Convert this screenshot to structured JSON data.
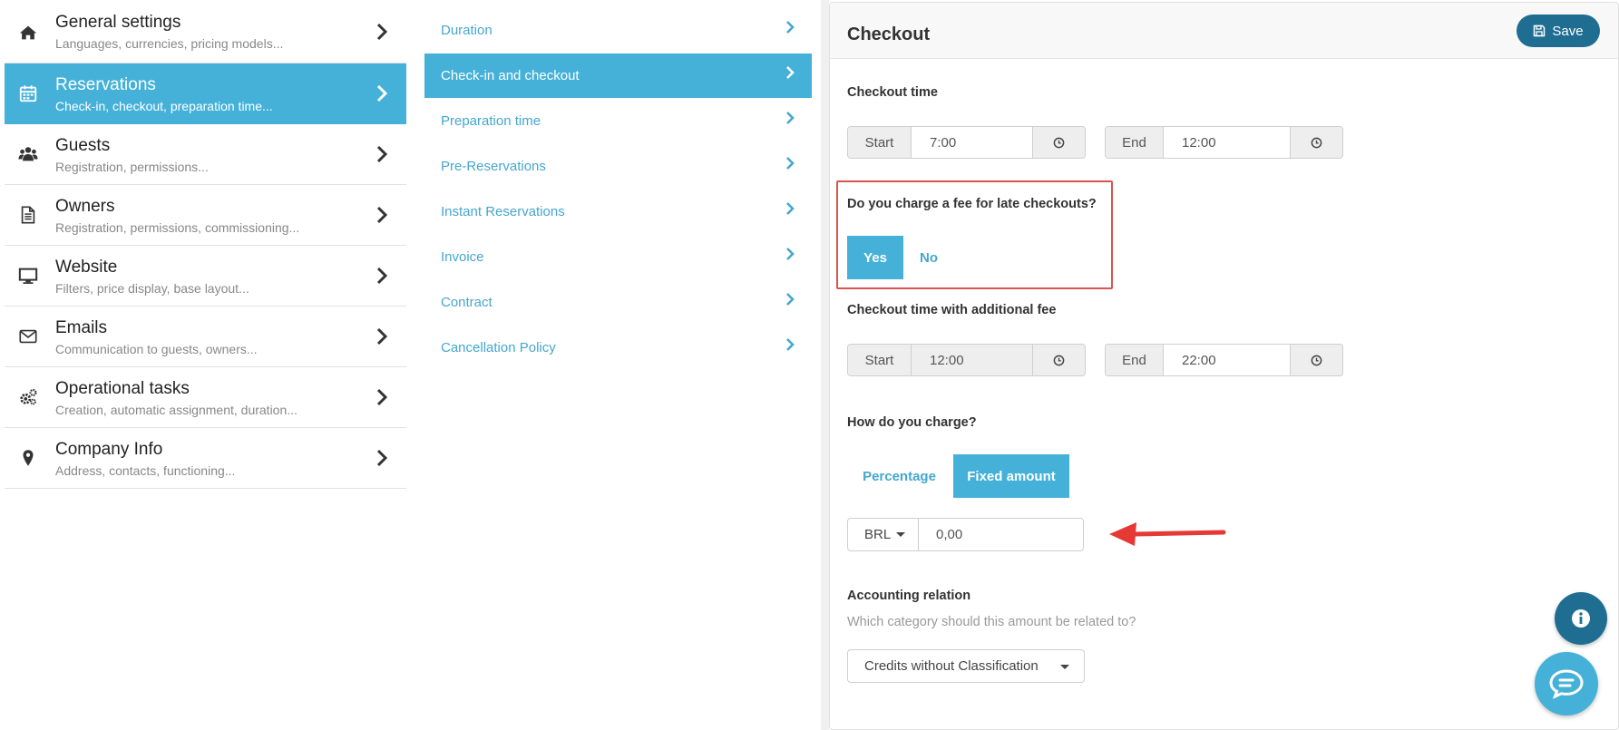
{
  "sidebar": {
    "items": [
      {
        "icon": "home-icon",
        "title": "General settings",
        "subtitle": "Languages, currencies, pricing models...",
        "active": false
      },
      {
        "icon": "calendar-icon",
        "title": "Reservations",
        "subtitle": "Check-in, checkout, preparation time...",
        "active": true
      },
      {
        "icon": "users-icon",
        "title": "Guests",
        "subtitle": "Registration, permissions...",
        "active": false
      },
      {
        "icon": "document-icon",
        "title": "Owners",
        "subtitle": "Registration, permissions, commissioning...",
        "active": false
      },
      {
        "icon": "monitor-icon",
        "title": "Website",
        "subtitle": "Filters, price display, base layout...",
        "active": false
      },
      {
        "icon": "envelope-icon",
        "title": "Emails",
        "subtitle": "Communication to guests, owners...",
        "active": false
      },
      {
        "icon": "gears-icon",
        "title": "Operational tasks",
        "subtitle": "Creation, automatic assignment, duration...",
        "active": false
      },
      {
        "icon": "map-pin-icon",
        "title": "Company Info",
        "subtitle": "Address, contacts, functioning...",
        "active": false
      }
    ]
  },
  "submenu": {
    "items": [
      {
        "label": "Duration",
        "active": false
      },
      {
        "label": "Check-in and checkout",
        "active": true
      },
      {
        "label": "Preparation time",
        "active": false
      },
      {
        "label": "Pre-Reservations",
        "active": false
      },
      {
        "label": "Instant Reservations",
        "active": false
      },
      {
        "label": "Invoice",
        "active": false
      },
      {
        "label": "Contract",
        "active": false
      },
      {
        "label": "Cancellation Policy",
        "active": false
      }
    ]
  },
  "panel": {
    "title": "Checkout",
    "save_label": "Save",
    "checkout_time": {
      "label": "Checkout time",
      "start_label": "Start",
      "start_value": "7:00",
      "end_label": "End",
      "end_value": "12:00"
    },
    "late_fee": {
      "question": "Do you charge a fee for late checkouts?",
      "yes_label": "Yes",
      "no_label": "No",
      "selected": "Yes"
    },
    "additional_fee_time": {
      "label": "Checkout time with additional fee",
      "start_label": "Start",
      "start_value": "12:00",
      "end_label": "End",
      "end_value": "22:00"
    },
    "charge": {
      "label": "How do you charge?",
      "percentage_label": "Percentage",
      "fixed_label": "Fixed amount",
      "selected": "Fixed amount",
      "currency": "BRL",
      "amount": "0,00"
    },
    "accounting": {
      "label": "Accounting relation",
      "help": "Which category should this amount be related to?",
      "selected": "Credits without Classification"
    }
  },
  "colors": {
    "accent": "#45b1d8",
    "link": "#45a7cf",
    "primary_dark": "#1f6e92",
    "highlight_box": "#d9534f",
    "arrow": "#e53935"
  }
}
